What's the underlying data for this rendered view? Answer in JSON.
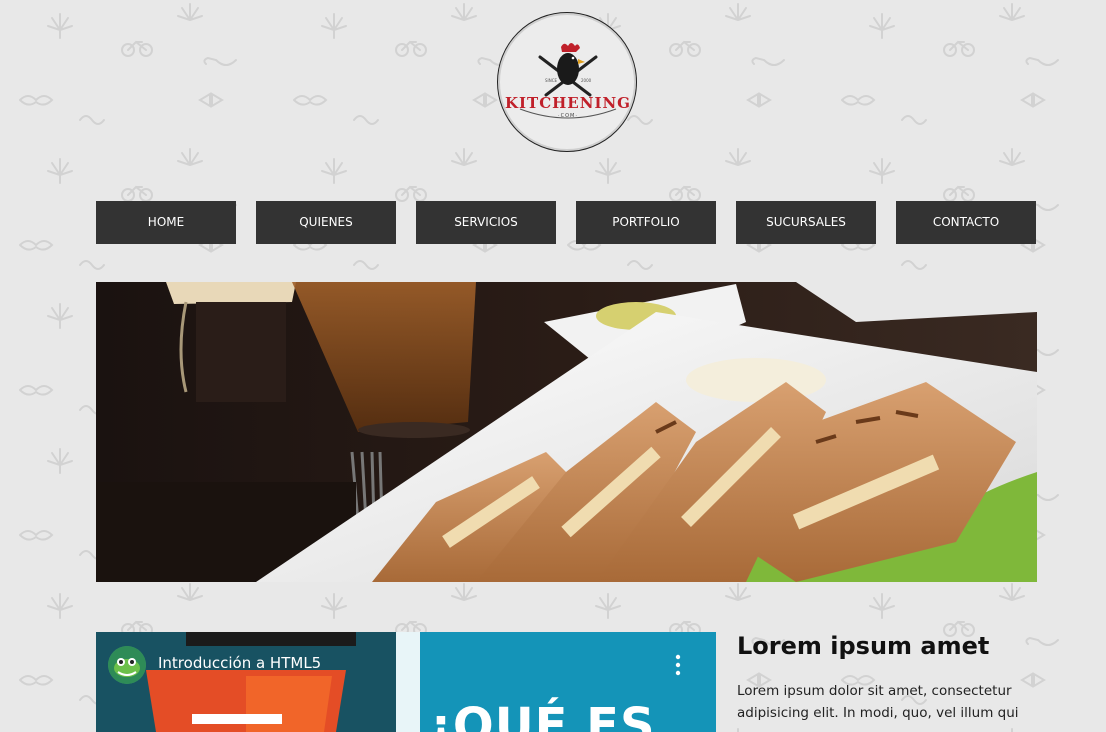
{
  "logo": {
    "name": "KITCHENING",
    "sub": "·COM·",
    "since_left": "SINCE",
    "since_right": "2000"
  },
  "nav": {
    "items": [
      {
        "label": "HOME"
      },
      {
        "label": "QUIENES"
      },
      {
        "label": "SERVICIOS"
      },
      {
        "label": "PORTFOLIO"
      },
      {
        "label": "SUCURSALES"
      },
      {
        "label": "CONTACTO"
      }
    ]
  },
  "video": {
    "title": "Introducción a HTML5",
    "thumbnail_text": "¡QUÉ ES"
  },
  "article": {
    "title": "Lorem ipsum amet",
    "body": "Lorem ipsum dolor sit amet, consectetur adipisicing elit. In modi, quo, vel illum qui"
  },
  "colors": {
    "background": "#e8e8e8",
    "nav_bg": "#333333",
    "nav_text": "#ffffff",
    "logo_red": "#c0202a"
  }
}
